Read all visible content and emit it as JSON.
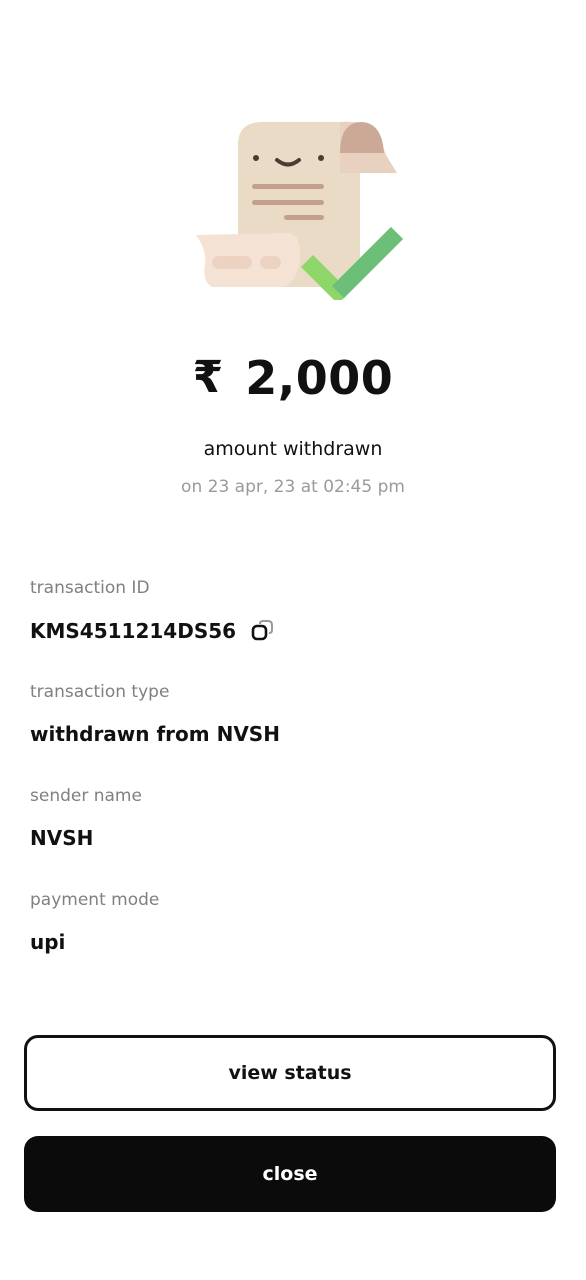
{
  "summary": {
    "currency_symbol": "₹",
    "amount": "2,000",
    "caption": "amount withdrawn",
    "date_text": "on 23 apr, 23 at 02:45 pm"
  },
  "illustration": {
    "icon": "receipt-check-icon"
  },
  "details": [
    {
      "label": "transaction ID",
      "value": "KMS4511214DS56"
    },
    {
      "label": "transaction type",
      "value": "withdrawn from NVSH"
    },
    {
      "label": "sender name",
      "value": "NVSH"
    },
    {
      "label": "payment mode",
      "value": "upi"
    }
  ],
  "actions": {
    "view_status_label": "view status",
    "close_label": "close"
  },
  "colors": {
    "primary_black": "#0b0b0b",
    "muted_text": "#808080",
    "success_green": "#8ed56a"
  }
}
